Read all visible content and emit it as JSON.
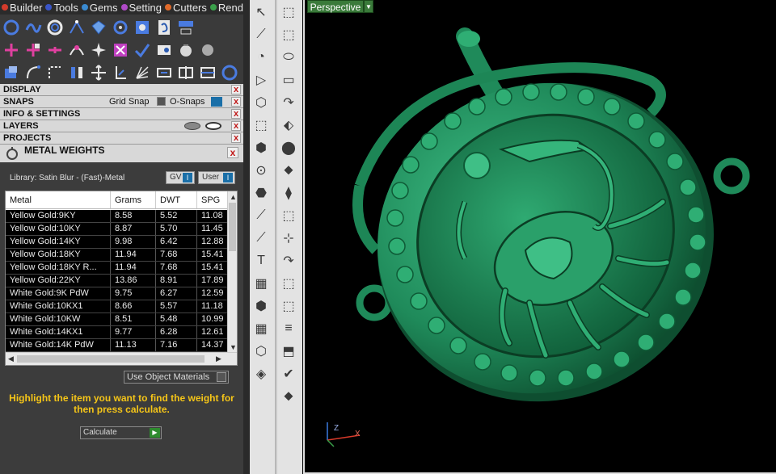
{
  "menubar": {
    "items": [
      {
        "label": "Builder",
        "color": "#d43b2b"
      },
      {
        "label": "Tools",
        "color": "#3a55c8"
      },
      {
        "label": "Gems",
        "color": "#3a8ad0"
      },
      {
        "label": "Setting",
        "color": "#b04ac8"
      },
      {
        "label": "Cutters",
        "color": "#e06a2a"
      },
      {
        "label": "Render",
        "color": "#3aa04a"
      }
    ]
  },
  "sections": {
    "display": "DISPLAY",
    "snaps": "SNAPS",
    "grid_snap": "Grid Snap",
    "o_snaps": "O-Snaps",
    "info_settings": "INFO & SETTINGS",
    "layers": "LAYERS",
    "projects": "PROJECTS",
    "close_glyph": "x"
  },
  "metal_weights": {
    "title": "METAL WEIGHTS",
    "library": "Library: Satin Blur - (Fast)-Metal",
    "gv_label": "GV",
    "user_label": "User",
    "columns": [
      "Metal",
      "Grams",
      "DWT",
      "SPG"
    ],
    "rows": [
      [
        "Yellow Gold:9KY",
        "8.58",
        "5.52",
        "11.08"
      ],
      [
        "Yellow Gold:10KY",
        "8.87",
        "5.70",
        "11.45"
      ],
      [
        "Yellow Gold:14KY",
        "9.98",
        "6.42",
        "12.88"
      ],
      [
        "Yellow Gold:18KY",
        "11.94",
        "7.68",
        "15.41"
      ],
      [
        "Yellow Gold:18KY R...",
        "11.94",
        "7.68",
        "15.41"
      ],
      [
        "Yellow Gold:22KY",
        "13.86",
        "8.91",
        "17.89"
      ],
      [
        "White Gold:9K PdW",
        "9.75",
        "6.27",
        "12.59"
      ],
      [
        "White Gold:10KX1",
        "8.66",
        "5.57",
        "11.18"
      ],
      [
        "White Gold:10KW",
        "8.51",
        "5.48",
        "10.99"
      ],
      [
        "White Gold:14KX1",
        "9.77",
        "6.28",
        "12.61"
      ],
      [
        "White Gold:14K PdW",
        "11.13",
        "7.16",
        "14.37"
      ]
    ],
    "use_object_materials": "Use Object Materials",
    "hint": "Highlight the item you want to find the weight for then press calculate.",
    "calculate": "Calculate"
  },
  "viewport": {
    "view_name": "Perspective",
    "model_color": "#1f8a5a",
    "axis": {
      "z": "Z",
      "x": "X"
    }
  }
}
